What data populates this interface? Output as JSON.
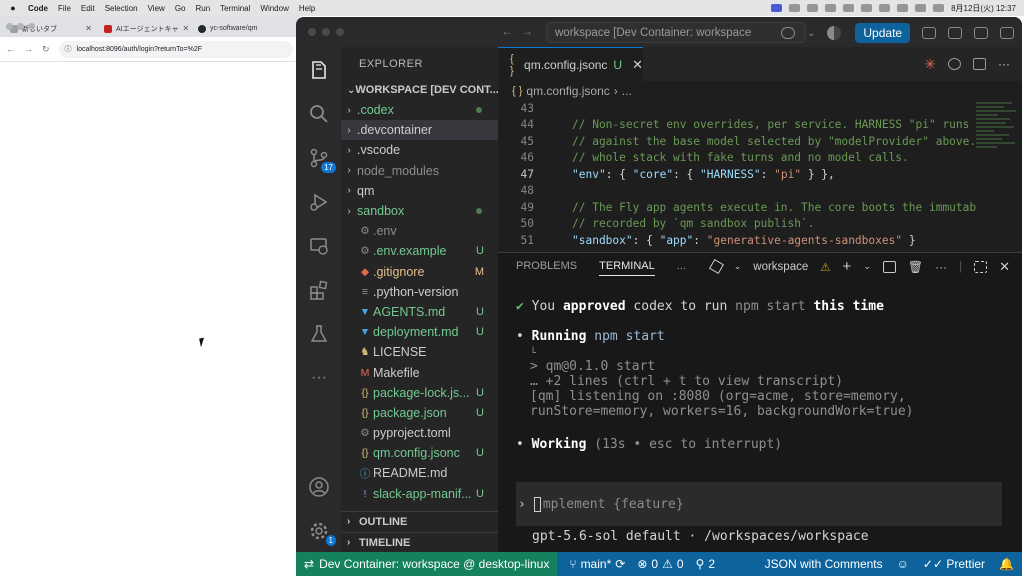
{
  "menubar": {
    "app": "Code",
    "items": [
      "File",
      "Edit",
      "Selection",
      "View",
      "Go",
      "Run",
      "Terminal",
      "Window",
      "Help"
    ],
    "clock": "8月12日(火) 12:37"
  },
  "browser": {
    "tabs": [
      {
        "title": "新しいタブ",
        "color": "#9aa0a6"
      },
      {
        "title": "AIエージェントキャ",
        "color": "#c5221f"
      },
      {
        "title": "yc-software/qm",
        "color": "#24292f"
      }
    ],
    "url": "localhost:8096/auth/login?returnTo=%2F"
  },
  "vscode": {
    "command_center": "workspace [Dev Container: workspace",
    "update_label": "Update",
    "activity_badges": {
      "scm": "17",
      "accounts": "1"
    },
    "explorer": {
      "title": "EXPLORER",
      "section": "WORKSPACE [DEV CONT...",
      "items": [
        {
          "label": ".codex",
          "kind": "folder",
          "color": "#73c991",
          "status": "dot"
        },
        {
          "label": ".devcontainer",
          "kind": "folder",
          "color": "#cccccc",
          "status": ""
        },
        {
          "label": ".vscode",
          "kind": "folder",
          "color": "#cccccc",
          "status": ""
        },
        {
          "label": "node_modules",
          "kind": "folder",
          "color": "#8c8c8c",
          "status": ""
        },
        {
          "label": "qm",
          "kind": "folder",
          "color": "#cccccc",
          "status": ""
        },
        {
          "label": "sandbox",
          "kind": "folder",
          "color": "#73c991",
          "status": "dot"
        },
        {
          "label": ".env",
          "kind": "gear",
          "color": "#8c8c8c",
          "status": ""
        },
        {
          "label": ".env.example",
          "kind": "gear",
          "color": "#73c991",
          "status": "U"
        },
        {
          "label": ".gitignore",
          "kind": "git",
          "color": "#e2c08d",
          "status": "M"
        },
        {
          "label": ".python-version",
          "kind": "text",
          "color": "#cccccc",
          "status": ""
        },
        {
          "label": "AGENTS.md",
          "kind": "md",
          "color": "#73c991",
          "status": "U"
        },
        {
          "label": "deployment.md",
          "kind": "md",
          "color": "#73c991",
          "status": "U"
        },
        {
          "label": "LICENSE",
          "kind": "license",
          "color": "#cccccc",
          "status": ""
        },
        {
          "label": "Makefile",
          "kind": "make",
          "color": "#cccccc",
          "status": ""
        },
        {
          "label": "package-lock.js...",
          "kind": "json",
          "color": "#73c991",
          "status": "U"
        },
        {
          "label": "package.json",
          "kind": "json",
          "color": "#73c991",
          "status": "U"
        },
        {
          "label": "pyproject.toml",
          "kind": "gear",
          "color": "#cccccc",
          "status": ""
        },
        {
          "label": "qm.config.jsonc",
          "kind": "json",
          "color": "#73c991",
          "status": "U"
        },
        {
          "label": "README.md",
          "kind": "info",
          "color": "#cccccc",
          "status": ""
        },
        {
          "label": "slack-app-manif...",
          "kind": "excl",
          "color": "#73c991",
          "status": "U"
        }
      ],
      "outline": "OUTLINE",
      "timeline": "TIMELINE"
    },
    "editor": {
      "tab_label": "qm.config.jsonc",
      "tab_state": "U",
      "breadcrumb_file": "qm.config.jsonc",
      "breadcrumb_more": "...",
      "current_line": "47",
      "lines": [
        {
          "n": "43",
          "parts": []
        },
        {
          "n": "44",
          "parts": [
            {
              "t": "// Non-secret env overrides, per service. HARNESS \"pi\" runs",
              "c": "cm"
            }
          ]
        },
        {
          "n": "45",
          "parts": [
            {
              "t": "// against the base model selected by \"modelProvider\" above.",
              "c": "cm"
            }
          ]
        },
        {
          "n": "46",
          "parts": [
            {
              "t": "// whole stack with fake turns and no model calls.",
              "c": "cm"
            }
          ]
        },
        {
          "n": "47",
          "parts": [
            {
              "t": "\"env\"",
              "c": "k"
            },
            {
              "t": ": { ",
              "c": "p"
            },
            {
              "t": "\"core\"",
              "c": "k"
            },
            {
              "t": ": { ",
              "c": "p"
            },
            {
              "t": "\"HARNESS\"",
              "c": "k"
            },
            {
              "t": ": ",
              "c": "p"
            },
            {
              "t": "\"pi\"",
              "c": "s"
            },
            {
              "t": " } },",
              "c": "p"
            }
          ]
        },
        {
          "n": "48",
          "parts": []
        },
        {
          "n": "49",
          "parts": [
            {
              "t": "// The Fly app agents execute in. The core boots the immutab",
              "c": "cm"
            }
          ]
        },
        {
          "n": "50",
          "parts": [
            {
              "t": "// recorded by `qm sandbox publish`.",
              "c": "cm"
            }
          ]
        },
        {
          "n": "51",
          "parts": [
            {
              "t": "\"sandbox\"",
              "c": "k"
            },
            {
              "t": ": { ",
              "c": "p"
            },
            {
              "t": "\"app\"",
              "c": "k"
            },
            {
              "t": ": ",
              "c": "p"
            },
            {
              "t": "\"generative-agents-sandboxes\"",
              "c": "s"
            },
            {
              "t": " }",
              "c": "p"
            }
          ]
        }
      ]
    },
    "panel": {
      "tabs": [
        "PROBLEMS",
        "TERMINAL",
        "..."
      ],
      "active_tab": "TERMINAL",
      "terminal_name": "workspace",
      "approved": {
        "check": "✔",
        "a": "You ",
        "b": "approved",
        "c": " codex to run ",
        "d": "npm start",
        "e": " this time"
      },
      "running": {
        "bullet": "•",
        "a": "Running",
        "b": " npm start"
      },
      "tree_mark": "└",
      "output": [
        "> qm@0.1.0 start",
        "… +2 lines (ctrl + t to view transcript)",
        "[qm] listening on :8080 (org=acme, store=memory,",
        "runStore=memory, workers=16, backgroundWork=true)"
      ],
      "working": {
        "bullet": "•",
        "a": "Working",
        "b": " (13s • esc to interrupt)"
      },
      "prompt_arrow": "›",
      "prompt_placeholder": "mplement {feature}",
      "model_line": "gpt-5.6-sol default · /workspaces/workspace"
    },
    "status": {
      "remote": "Dev Container: workspace @ desktop-linux",
      "branch": "main*",
      "errors": "0",
      "warnings": "0",
      "ports": "2",
      "language": "JSON with Comments",
      "formatter": "Prettier"
    }
  }
}
